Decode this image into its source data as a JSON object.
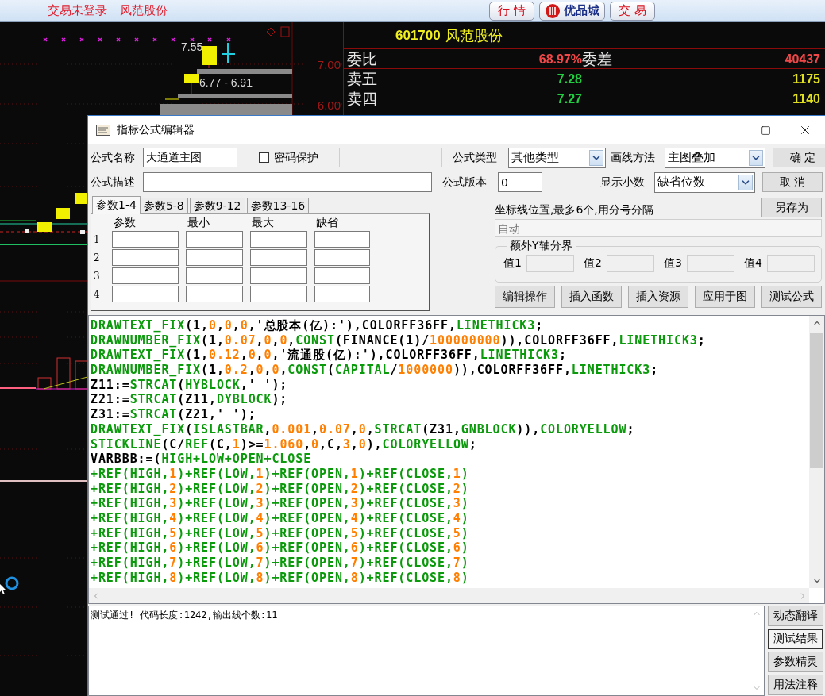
{
  "top_bar": {
    "status": "交易未登录",
    "stock": "风范股份",
    "buttons": [
      {
        "label": "行 情",
        "kind": "plain"
      },
      {
        "label": "优品城",
        "kind": "logo"
      },
      {
        "label": "交 易",
        "kind": "plain"
      }
    ]
  },
  "chart": {
    "price_labels": [
      "7.00",
      "6.00"
    ],
    "annotations": [
      "7.55",
      "6.77 - 6.91"
    ]
  },
  "quote": {
    "code": "601700",
    "name": "风范股份",
    "ratio": {
      "label": "委比",
      "value": "68.97%",
      "diff_label": "委差",
      "diff": "40437"
    },
    "asks": [
      {
        "label": "卖五",
        "price": "7.28",
        "volume": "1175"
      },
      {
        "label": "卖四",
        "price": "7.27",
        "volume": "1140"
      }
    ]
  },
  "dialog": {
    "title": "指标公式编辑器",
    "name": {
      "label": "公式名称",
      "value": "大通道主图"
    },
    "password": {
      "label": "密码保护",
      "checked": false
    },
    "description": {
      "label": "公式描述"
    },
    "type": {
      "label": "公式类型",
      "value": "其他类型"
    },
    "draw_method": {
      "label": "画线方法",
      "value": "主图叠加"
    },
    "version": {
      "label": "公式版本",
      "value": "0"
    },
    "decimals": {
      "label": "显示小数",
      "value": "缺省位数"
    },
    "side_buttons": [
      "确 定",
      "取 消",
      "另存为"
    ],
    "param_tabs": [
      {
        "label": "参数1-4",
        "selected": true
      },
      {
        "label": "参数5-8",
        "selected": false
      },
      {
        "label": "参数9-12",
        "selected": false
      },
      {
        "label": "参数13-16",
        "selected": false
      }
    ],
    "param_headers": [
      "参数",
      "最小",
      "最大",
      "缺省"
    ],
    "param_rows": [
      "1",
      "2",
      "3",
      "4"
    ],
    "axis": {
      "label": "坐标线位置,最多6个,用分号分隔",
      "placeholder": "自动"
    },
    "y_bounds": {
      "title": "额外Y轴分界",
      "labels": [
        "值1",
        "值2",
        "值3",
        "值4"
      ]
    },
    "actions": [
      "编辑操作",
      "插入函数",
      "插入资源",
      "应用于图",
      "测试公式"
    ],
    "code_lines": [
      [
        {
          "text": "DRAWTEXT_FIX",
          "kind": "fn"
        },
        {
          "text": "(1,",
          "kind": "text"
        },
        {
          "text": "0",
          "kind": "num"
        },
        {
          "text": ",",
          "kind": "text"
        },
        {
          "text": "0",
          "kind": "num"
        },
        {
          "text": ",",
          "kind": "text"
        },
        {
          "text": "0",
          "kind": "num"
        },
        {
          "text": ",'总股本(亿):'),COLORFF36FF,",
          "kind": "text"
        },
        {
          "text": "LINETHICK3",
          "kind": "fn"
        },
        {
          "text": ";",
          "kind": "text"
        }
      ],
      [
        {
          "text": "DRAWNUMBER_FIX",
          "kind": "fn"
        },
        {
          "text": "(1,",
          "kind": "text"
        },
        {
          "text": "0.07",
          "kind": "num"
        },
        {
          "text": ",",
          "kind": "text"
        },
        {
          "text": "0",
          "kind": "num"
        },
        {
          "text": ",",
          "kind": "text"
        },
        {
          "text": "0",
          "kind": "num"
        },
        {
          "text": ",",
          "kind": "text"
        },
        {
          "text": "CONST",
          "kind": "fn"
        },
        {
          "text": "(FINANCE(1)/",
          "kind": "text"
        },
        {
          "text": "100000000",
          "kind": "num"
        },
        {
          "text": ")),COLORFF36FF,",
          "kind": "text"
        },
        {
          "text": "LINETHICK3",
          "kind": "fn"
        },
        {
          "text": ";",
          "kind": "text"
        }
      ],
      [
        {
          "text": "DRAWTEXT_FIX",
          "kind": "fn"
        },
        {
          "text": "(1,",
          "kind": "text"
        },
        {
          "text": "0.12",
          "kind": "num"
        },
        {
          "text": ",",
          "kind": "text"
        },
        {
          "text": "0",
          "kind": "num"
        },
        {
          "text": ",",
          "kind": "text"
        },
        {
          "text": "0",
          "kind": "num"
        },
        {
          "text": ",'流通股(亿):'),COLORFF36FF,",
          "kind": "text"
        },
        {
          "text": "LINETHICK3",
          "kind": "fn"
        },
        {
          "text": ";",
          "kind": "text"
        }
      ],
      [
        {
          "text": "DRAWNUMBER_FIX",
          "kind": "fn"
        },
        {
          "text": "(1,",
          "kind": "text"
        },
        {
          "text": "0.2",
          "kind": "num"
        },
        {
          "text": ",",
          "kind": "text"
        },
        {
          "text": "0",
          "kind": "num"
        },
        {
          "text": ",",
          "kind": "text"
        },
        {
          "text": "0",
          "kind": "num"
        },
        {
          "text": ",",
          "kind": "text"
        },
        {
          "text": "CONST",
          "kind": "fn"
        },
        {
          "text": "(",
          "kind": "text"
        },
        {
          "text": "CAPITAL",
          "kind": "fn"
        },
        {
          "text": "/",
          "kind": "text"
        },
        {
          "text": "1000000",
          "kind": "num"
        },
        {
          "text": ")),COLORFF36FF,",
          "kind": "text"
        },
        {
          "text": "LINETHICK3",
          "kind": "fn"
        },
        {
          "text": ";",
          "kind": "text"
        }
      ],
      [
        {
          "text": "Z11:=",
          "kind": "text"
        },
        {
          "text": "STRCAT",
          "kind": "fn"
        },
        {
          "text": "(",
          "kind": "text"
        },
        {
          "text": "HYBLOCK",
          "kind": "fn"
        },
        {
          "text": ",' ');",
          "kind": "text"
        }
      ],
      [
        {
          "text": "Z21:=",
          "kind": "text"
        },
        {
          "text": "STRCAT",
          "kind": "fn"
        },
        {
          "text": "(Z11,",
          "kind": "text"
        },
        {
          "text": "DYBLOCK",
          "kind": "fn"
        },
        {
          "text": ");",
          "kind": "text"
        }
      ],
      [
        {
          "text": "Z31:=",
          "kind": "text"
        },
        {
          "text": "STRCAT",
          "kind": "fn"
        },
        {
          "text": "(Z21,' ');",
          "kind": "text"
        }
      ],
      [
        {
          "text": "DRAWTEXT_FIX",
          "kind": "fn"
        },
        {
          "text": "(",
          "kind": "text"
        },
        {
          "text": "ISLASTBAR",
          "kind": "fn"
        },
        {
          "text": ",",
          "kind": "text"
        },
        {
          "text": "0.001",
          "kind": "num"
        },
        {
          "text": ",",
          "kind": "text"
        },
        {
          "text": "0.07",
          "kind": "num"
        },
        {
          "text": ",",
          "kind": "text"
        },
        {
          "text": "0",
          "kind": "num"
        },
        {
          "text": ",",
          "kind": "text"
        },
        {
          "text": "STRCAT",
          "kind": "fn"
        },
        {
          "text": "(Z31,",
          "kind": "text"
        },
        {
          "text": "GNBLOCK",
          "kind": "fn"
        },
        {
          "text": ")),",
          "kind": "text"
        },
        {
          "text": "COLORYELLOW",
          "kind": "fn"
        },
        {
          "text": ";",
          "kind": "text"
        }
      ],
      [
        {
          "text": "STICKLINE",
          "kind": "fn"
        },
        {
          "text": "(C/",
          "kind": "text"
        },
        {
          "text": "REF",
          "kind": "fn"
        },
        {
          "text": "(C,",
          "kind": "text"
        },
        {
          "text": "1",
          "kind": "num"
        },
        {
          "text": ")>=",
          "kind": "text"
        },
        {
          "text": "1.060",
          "kind": "num"
        },
        {
          "text": ",",
          "kind": "text"
        },
        {
          "text": "0",
          "kind": "num"
        },
        {
          "text": ",C,",
          "kind": "text"
        },
        {
          "text": "3",
          "kind": "num"
        },
        {
          "text": ",",
          "kind": "text"
        },
        {
          "text": "0",
          "kind": "num"
        },
        {
          "text": "),",
          "kind": "text"
        },
        {
          "text": "COLORYELLOW",
          "kind": "fn"
        },
        {
          "text": ";",
          "kind": "text"
        }
      ],
      [
        {
          "text": "VARBBB:=(",
          "kind": "text"
        },
        {
          "text": "HIGH+LOW+OPEN+CLOSE",
          "kind": "fn"
        }
      ],
      [
        {
          "text": "+REF(HIGH,",
          "kind": "fn"
        },
        {
          "text": "1",
          "kind": "num"
        },
        {
          "text": ")+REF(LOW,",
          "kind": "fn"
        },
        {
          "text": "1",
          "kind": "num"
        },
        {
          "text": ")+REF(OPEN,",
          "kind": "fn"
        },
        {
          "text": "1",
          "kind": "num"
        },
        {
          "text": ")+REF(CLOSE,",
          "kind": "fn"
        },
        {
          "text": "1",
          "kind": "num"
        },
        {
          "text": ")",
          "kind": "fn"
        }
      ],
      [
        {
          "text": "+REF(HIGH,",
          "kind": "fn"
        },
        {
          "text": "2",
          "kind": "num"
        },
        {
          "text": ")+REF(LOW,",
          "kind": "fn"
        },
        {
          "text": "2",
          "kind": "num"
        },
        {
          "text": ")+REF(OPEN,",
          "kind": "fn"
        },
        {
          "text": "2",
          "kind": "num"
        },
        {
          "text": ")+REF(CLOSE,",
          "kind": "fn"
        },
        {
          "text": "2",
          "kind": "num"
        },
        {
          "text": ")",
          "kind": "fn"
        }
      ],
      [
        {
          "text": "+REF(HIGH,",
          "kind": "fn"
        },
        {
          "text": "3",
          "kind": "num"
        },
        {
          "text": ")+REF(LOW,",
          "kind": "fn"
        },
        {
          "text": "3",
          "kind": "num"
        },
        {
          "text": ")+REF(OPEN,",
          "kind": "fn"
        },
        {
          "text": "3",
          "kind": "num"
        },
        {
          "text": ")+REF(CLOSE,",
          "kind": "fn"
        },
        {
          "text": "3",
          "kind": "num"
        },
        {
          "text": ")",
          "kind": "fn"
        }
      ],
      [
        {
          "text": "+REF(HIGH,",
          "kind": "fn"
        },
        {
          "text": "4",
          "kind": "num"
        },
        {
          "text": ")+REF(LOW,",
          "kind": "fn"
        },
        {
          "text": "4",
          "kind": "num"
        },
        {
          "text": ")+REF(OPEN,",
          "kind": "fn"
        },
        {
          "text": "4",
          "kind": "num"
        },
        {
          "text": ")+REF(CLOSE,",
          "kind": "fn"
        },
        {
          "text": "4",
          "kind": "num"
        },
        {
          "text": ")",
          "kind": "fn"
        }
      ],
      [
        {
          "text": "+REF(HIGH,",
          "kind": "fn"
        },
        {
          "text": "5",
          "kind": "num"
        },
        {
          "text": ")+REF(LOW,",
          "kind": "fn"
        },
        {
          "text": "5",
          "kind": "num"
        },
        {
          "text": ")+REF(OPEN,",
          "kind": "fn"
        },
        {
          "text": "5",
          "kind": "num"
        },
        {
          "text": ")+REF(CLOSE,",
          "kind": "fn"
        },
        {
          "text": "5",
          "kind": "num"
        },
        {
          "text": ")",
          "kind": "fn"
        }
      ],
      [
        {
          "text": "+REF(HIGH,",
          "kind": "fn"
        },
        {
          "text": "6",
          "kind": "num"
        },
        {
          "text": ")+REF(LOW,",
          "kind": "fn"
        },
        {
          "text": "6",
          "kind": "num"
        },
        {
          "text": ")+REF(OPEN,",
          "kind": "fn"
        },
        {
          "text": "6",
          "kind": "num"
        },
        {
          "text": ")+REF(CLOSE,",
          "kind": "fn"
        },
        {
          "text": "6",
          "kind": "num"
        },
        {
          "text": ")",
          "kind": "fn"
        }
      ],
      [
        {
          "text": "+REF(HIGH,",
          "kind": "fn"
        },
        {
          "text": "7",
          "kind": "num"
        },
        {
          "text": ")+REF(LOW,",
          "kind": "fn"
        },
        {
          "text": "7",
          "kind": "num"
        },
        {
          "text": ")+REF(OPEN,",
          "kind": "fn"
        },
        {
          "text": "7",
          "kind": "num"
        },
        {
          "text": ")+REF(CLOSE,",
          "kind": "fn"
        },
        {
          "text": "7",
          "kind": "num"
        },
        {
          "text": ")",
          "kind": "fn"
        }
      ],
      [
        {
          "text": "+REF(HIGH,",
          "kind": "fn"
        },
        {
          "text": "8",
          "kind": "num"
        },
        {
          "text": ")+REF(LOW,",
          "kind": "fn"
        },
        {
          "text": "8",
          "kind": "num"
        },
        {
          "text": ")+REF(OPEN,",
          "kind": "fn"
        },
        {
          "text": "8",
          "kind": "num"
        },
        {
          "text": ")+REF(CLOSE,",
          "kind": "fn"
        },
        {
          "text": "8",
          "kind": "num"
        },
        {
          "text": ")",
          "kind": "fn"
        }
      ]
    ],
    "output": "测试通过! 代码长度:1242,输出线个数:11",
    "output_buttons": [
      {
        "label": "动态翻译",
        "selected": false
      },
      {
        "label": "测试结果",
        "selected": true
      },
      {
        "label": "参数精灵",
        "selected": false
      },
      {
        "label": "用法注释",
        "selected": false
      }
    ]
  }
}
